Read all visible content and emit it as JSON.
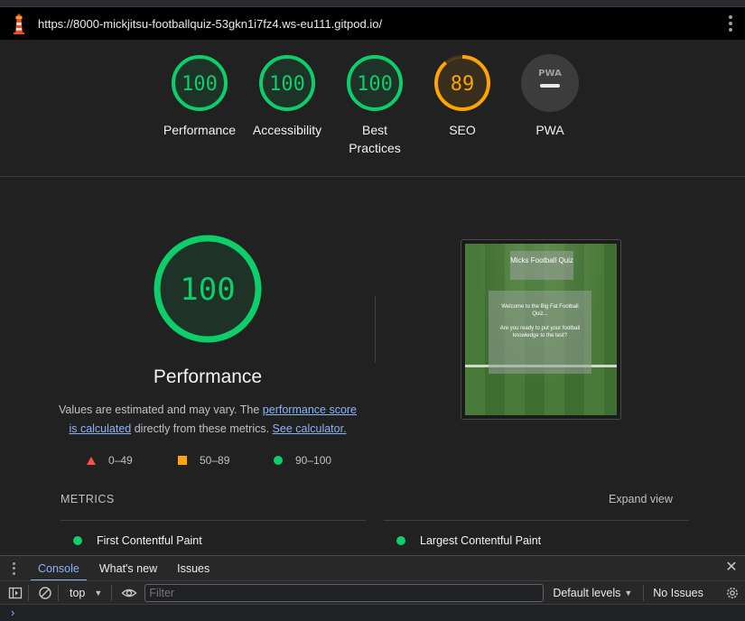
{
  "browser": {
    "url": "https://8000-mickjitsu-footballquiz-53gkn1i7fz4.ws-eu111.gitpod.io/"
  },
  "scores": [
    {
      "label": "Performance",
      "value": "100",
      "fraction": 1.0,
      "color": "#0cce6b"
    },
    {
      "label": "Accessibility",
      "value": "100",
      "fraction": 1.0,
      "color": "#0cce6b"
    },
    {
      "label": "Best Practices",
      "value": "100",
      "fraction": 1.0,
      "color": "#0cce6b"
    },
    {
      "label": "SEO",
      "value": "89",
      "fraction": 0.89,
      "color": "#ffa400"
    },
    {
      "label": "PWA",
      "value": "PWA",
      "color": "#9aa0a6"
    }
  ],
  "performance": {
    "score": "100",
    "title": "Performance",
    "desc_pre": "Values are estimated and may vary. The ",
    "link1": "performance score is calculated",
    "desc_mid": " directly from these metrics. ",
    "link2": "See calculator."
  },
  "legend": [
    {
      "range": "0–49",
      "shape": "triangle",
      "color": "#ff4e42"
    },
    {
      "range": "50–89",
      "shape": "square",
      "color": "#ffa400"
    },
    {
      "range": "90–100",
      "shape": "circle",
      "color": "#0cce6b"
    }
  ],
  "screenshot": {
    "heading": "Micks Football Quiz",
    "welcome": "Welcome to the Big Fat Football Quiz...",
    "question": "Are you ready to put your football knowledge to the test?"
  },
  "metrics": {
    "heading": "METRICS",
    "expand": "Expand view",
    "items": [
      "First Contentful Paint",
      "Largest Contentful Paint"
    ]
  },
  "devtools": {
    "tabs": [
      "Console",
      "What's new",
      "Issues"
    ],
    "context": "top",
    "filter_placeholder": "Filter",
    "levels": "Default levels",
    "issues": "No Issues",
    "prompt": "›"
  }
}
